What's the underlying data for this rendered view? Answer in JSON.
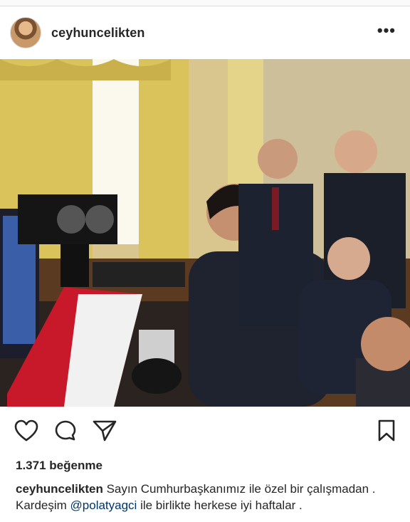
{
  "post": {
    "username": "ceyhuncelikten",
    "more_label": "•••",
    "likes": "1.371 beğenme",
    "caption": {
      "username": "ceyhuncelikten",
      "text_1": "Sayın Cumhurbaşkanımız ile özel bir çalışmadan . Kardeşim ",
      "mention": "@polatyagci",
      "text_2": " ile birlikte herkese iyi haftalar ."
    }
  },
  "icons": {
    "like": "heart-icon",
    "comment": "comment-icon",
    "share": "send-icon",
    "save": "bookmark-icon",
    "more": "more-icon"
  },
  "colors": {
    "text": "#262626",
    "mention": "#003569",
    "divider": "#dbdbdb"
  }
}
